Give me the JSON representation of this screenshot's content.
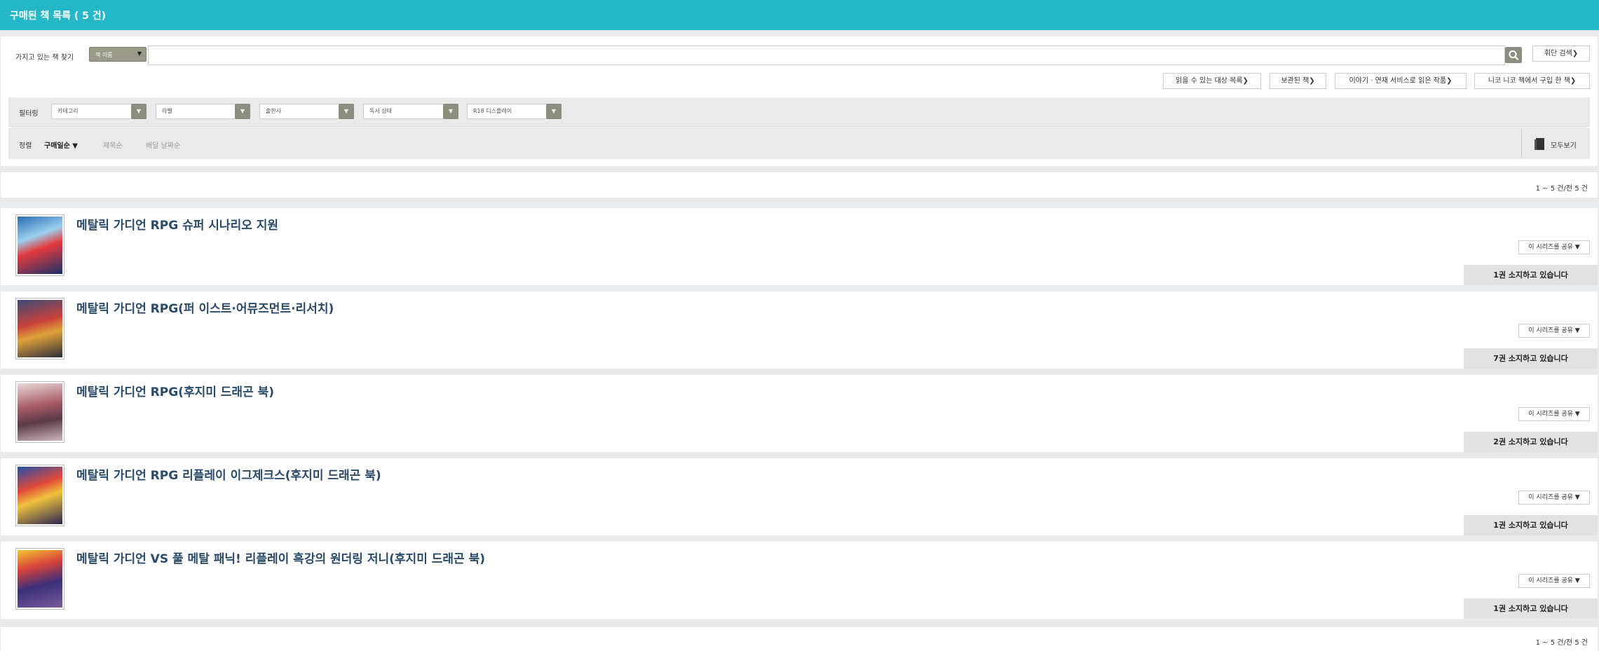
{
  "header": {
    "title": "구매된 책 목록 ( 5 건)"
  },
  "search": {
    "label": "가지고 있는 책 찾기",
    "field_select": "책 이름",
    "query": "",
    "advanced_label": "휘단 검색❯"
  },
  "links": [
    "읽을 수 있는 대상 목록❯",
    "보관된 책❯",
    "이야기 · 연재 서비스로 읽은 작품❯",
    "니코 니코 책에서 구입 한 책❯"
  ],
  "filters": {
    "label": "필터링",
    "selects": [
      "카테고리",
      "라벨",
      "출판사",
      "독서 상태",
      "R18 디스플레이"
    ]
  },
  "sort": {
    "label": "정렬",
    "options": [
      "구매일순 ▼",
      "제목순",
      "배달 날짜순"
    ],
    "view_all": "모두보기"
  },
  "pagination": {
    "text": "1 ~ 5 건/전 5 건"
  },
  "books": [
    {
      "title": "메탈릭 가디언 RPG 슈퍼 시나리오 지원",
      "share": "이 시리즈를 공유 ▼",
      "owned": "1권 소지하고 있습니다"
    },
    {
      "title": "메탈릭 가디언 RPG(퍼 이스트·어뮤즈먼트·리서치)",
      "share": "이 시리즈를 공유 ▼",
      "owned": "7권 소지하고 있습니다"
    },
    {
      "title": "메탈릭 가디언 RPG(후지미 드래곤 북)",
      "share": "이 시리즈를 공유 ▼",
      "owned": "2권 소지하고 있습니다"
    },
    {
      "title": "메탈릭 가디언 RPG 리플레이 이그제크스(후지미 드래곤 북)",
      "share": "이 시리즈를 공유 ▼",
      "owned": "1권 소지하고 있습니다"
    },
    {
      "title": "메탈릭 가디언 VS 풀 메탈 패닉! 리플레이 흑강의 원더링 저니(후지미 드래곤 북)",
      "share": "이 시리즈를 공유 ▼",
      "owned": "1권 소지하고 있습니다"
    }
  ],
  "colors": {
    "header": "#23b7c7",
    "title_text": "#2a4a6a",
    "control_dark": "#8e8e80"
  }
}
